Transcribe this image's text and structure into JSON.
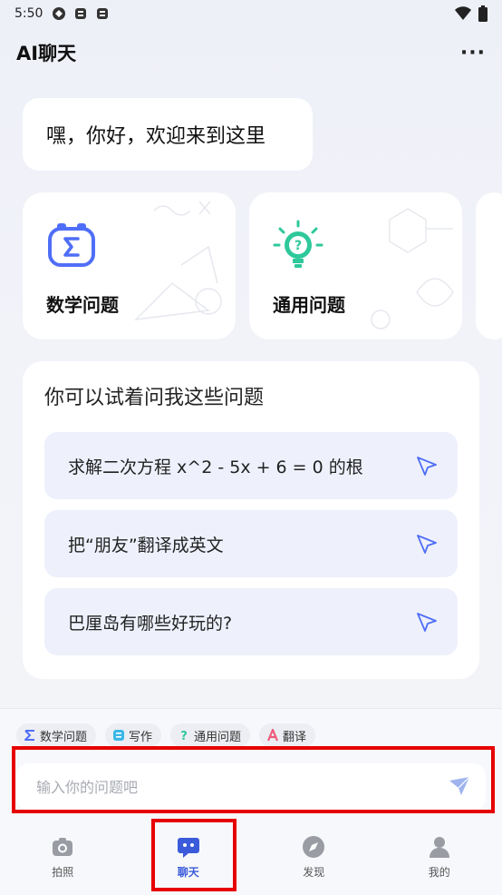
{
  "status_bar": {
    "time": "5:50"
  },
  "header": {
    "title": "AI聊天",
    "more": "···"
  },
  "greeting": "嘿，你好，欢迎来到这里",
  "features": [
    {
      "label": "数学问题",
      "icon": "math-sigma-icon"
    },
    {
      "label": "通用问题",
      "icon": "question-bulb-icon"
    }
  ],
  "suggestions": {
    "title": "你可以试着问我这些问题",
    "items": [
      "求解二次方程 x^2 - 5x + 6 = 0 的根",
      "把“朋友”翻译成英文",
      "巴厘岛有哪些好玩的?"
    ]
  },
  "chips": [
    {
      "label": "数学问题",
      "icon": "sigma-icon"
    },
    {
      "label": "写作",
      "icon": "write-icon"
    },
    {
      "label": "通用问题",
      "icon": "question-icon"
    },
    {
      "label": "翻译",
      "icon": "translate-icon"
    }
  ],
  "input": {
    "placeholder": "输入你的问题吧"
  },
  "tabs": [
    {
      "label": "拍照",
      "icon": "camera-icon"
    },
    {
      "label": "聊天",
      "icon": "chat-icon"
    },
    {
      "label": "发现",
      "icon": "compass-icon"
    },
    {
      "label": "我的",
      "icon": "user-icon"
    }
  ],
  "colors": {
    "accent": "#3b5bdb",
    "math_blue": "#4f6ef7",
    "bulb_green": "#2ec89b"
  }
}
